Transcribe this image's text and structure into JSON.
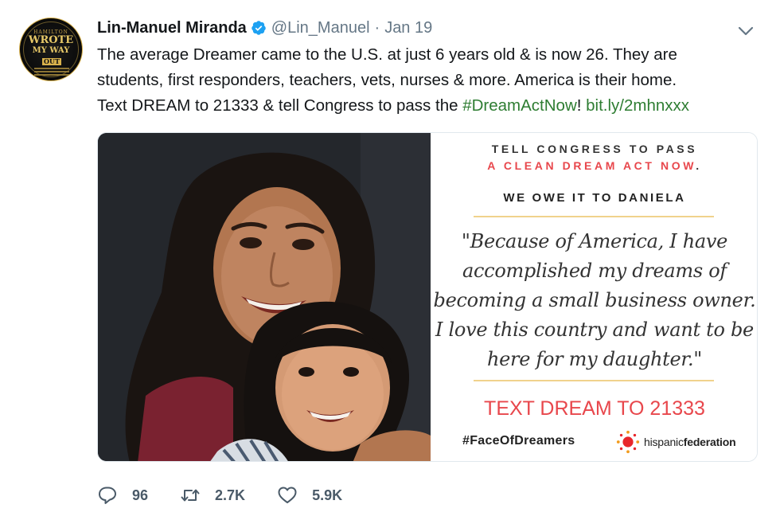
{
  "tweet": {
    "author": {
      "name": "Lin-Manuel Miranda",
      "handle": "@Lin_Manuel",
      "separator": "·",
      "date": "Jan 19",
      "avatar": {
        "small_text": "HAMILTON",
        "big_text_1": "WROTE",
        "big_text_2": "MY WAY",
        "box_text": "OUT"
      }
    },
    "text": {
      "line1": "The average Dreamer came to the U.S. at just 6 years old & is now 26.  They are",
      "line2": "students, first responders, teachers, vets, nurses & more.  America is their home.",
      "line3_prefix": "Text DREAM to 21333 & tell Congress to pass the ",
      "hashtag": "#DreamActNow",
      "line3_mid": "! ",
      "url": "bit.ly/2mhnxxx"
    },
    "media": {
      "head1": "TELL CONGRESS TO PASS",
      "head2": "A CLEAN DREAM ACT NOW",
      "head2_period": ".",
      "owe": "WE OWE IT TO DANIELA",
      "quote_lines": [
        "\"Because of America, I have",
        "accomplished my dreams of",
        "becoming a small business owner.",
        "I love this country and want to be",
        "here for my daughter.\""
      ],
      "cta": "TEXT DREAM TO 21333",
      "hashtag": "#FaceOfDreamers",
      "logo_part1": "hispanic",
      "logo_part2": "federation"
    },
    "actions": {
      "replies": "96",
      "retweets": "2.7K",
      "likes": "5.9K"
    },
    "colors": {
      "link": "#2e7d32",
      "verified": "#1da1f2",
      "accent_red": "#e8474c",
      "muted": "#657786"
    },
    "icons": [
      "verified-icon",
      "chevron-down-icon",
      "reply-icon",
      "retweet-icon",
      "like-icon"
    ]
  }
}
